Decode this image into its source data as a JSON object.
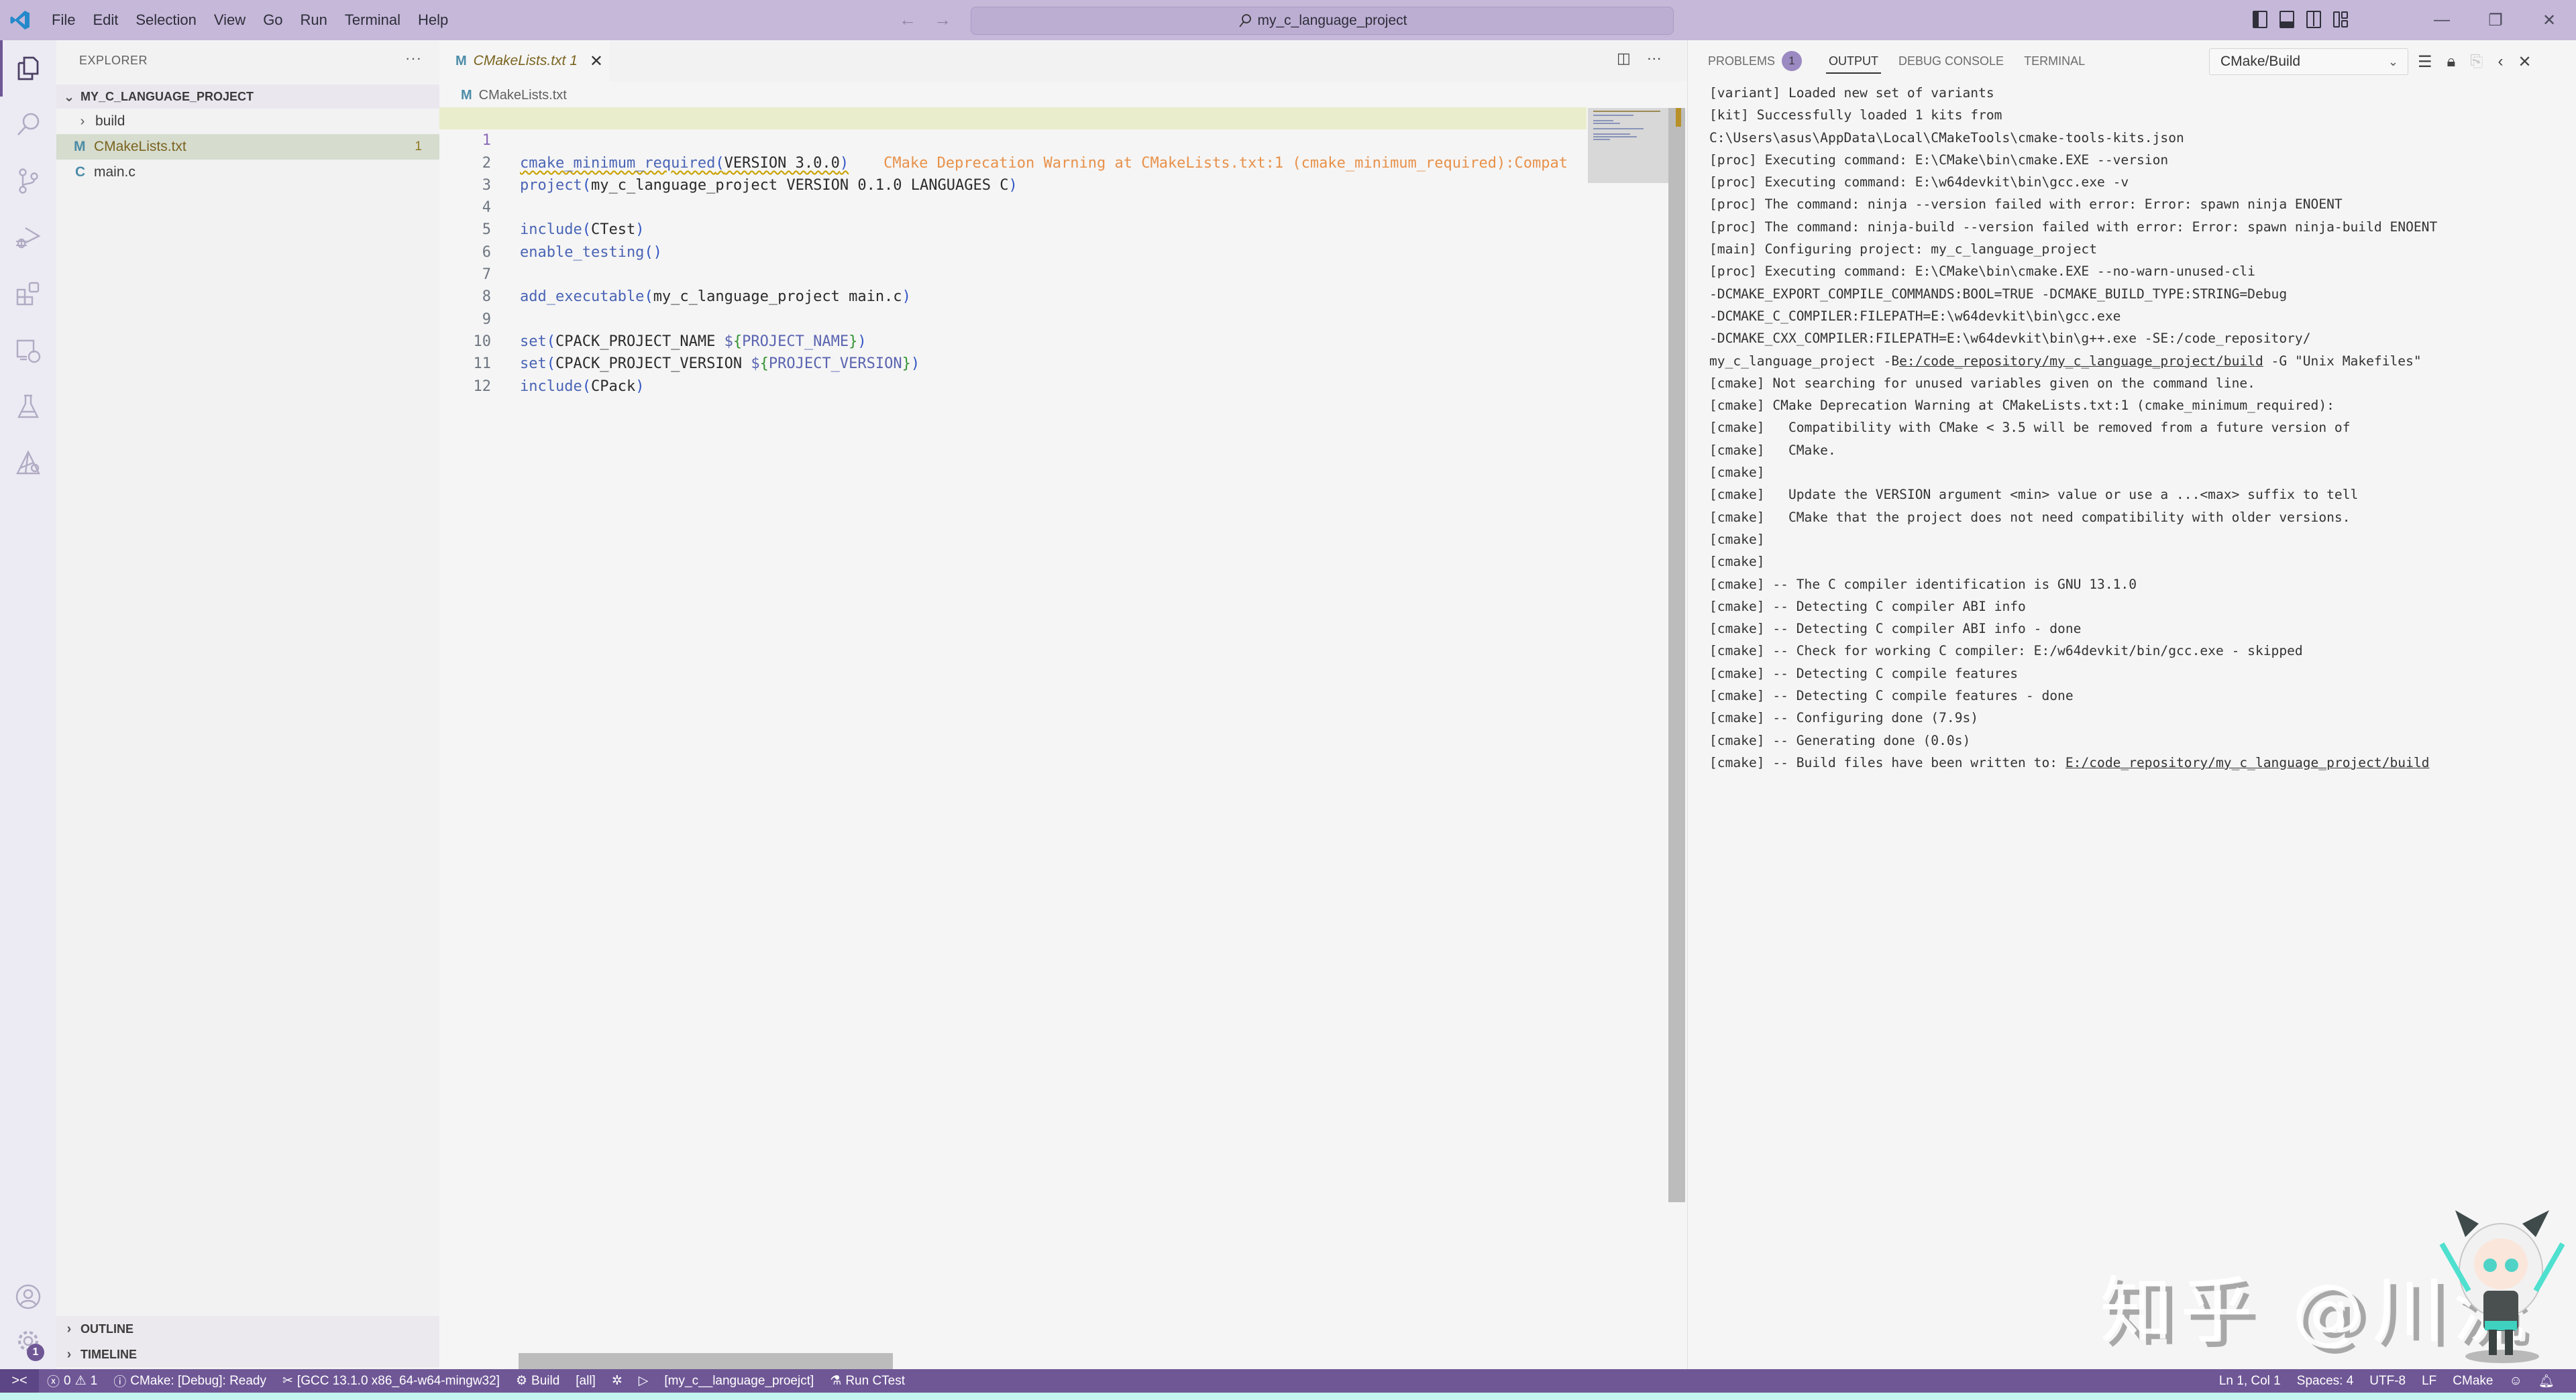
{
  "titlebar": {
    "menu": [
      "File",
      "Edit",
      "Selection",
      "View",
      "Go",
      "Run",
      "Terminal",
      "Help"
    ],
    "search_text": "my_c_language_project",
    "nav_back": "←",
    "nav_forward": "→",
    "window_controls": {
      "minimize": "—",
      "restore": "❐",
      "close": "✕"
    }
  },
  "activitybar": {
    "items": [
      "explorer",
      "search",
      "source-control",
      "run-and-debug",
      "extensions",
      "remote-explorer",
      "testing",
      "cmake"
    ],
    "bottom": [
      "accounts",
      "manage"
    ],
    "manage_badge": "1"
  },
  "sidebar": {
    "title": "EXPLORER",
    "more": "···",
    "project": "MY_C_LANGUAGE_PROJECT",
    "tree": [
      {
        "type": "folder",
        "name": "build",
        "icon": "›"
      },
      {
        "type": "file",
        "name": "CMakeLists.txt",
        "icon": "M",
        "count": "1",
        "selected": true
      },
      {
        "type": "file",
        "name": "main.c",
        "icon": "C"
      }
    ],
    "sections": [
      "OUTLINE",
      "TIMELINE"
    ]
  },
  "editor": {
    "tab": {
      "icon": "M",
      "label": "CMakeLists.txt 1",
      "close": "✕"
    },
    "breadcrumb": {
      "icon": "M",
      "label": "CMakeLists.txt"
    },
    "inline_warning": "CMake Deprecation Warning at CMakeLists.txt:1 (cmake_minimum_required):Compat",
    "lines": [
      {
        "n": "1",
        "fn": "cmake_minimum_required",
        "args": "VERSION 3.0.0"
      },
      {
        "n": "2",
        "fn": "project",
        "args": "my_c_language_project VERSION 0.1.0 LANGUAGES C"
      },
      {
        "n": "3"
      },
      {
        "n": "4",
        "fn": "include",
        "args": "CTest"
      },
      {
        "n": "5",
        "fn": "enable_testing",
        "args": ""
      },
      {
        "n": "6"
      },
      {
        "n": "7",
        "fn": "add_executable",
        "args": "my_c_language_project main.c"
      },
      {
        "n": "8"
      },
      {
        "n": "9",
        "fn": "set",
        "args": "CPACK_PROJECT_NAME ",
        "var": "PROJECT_NAME"
      },
      {
        "n": "10",
        "fn": "set",
        "args": "CPACK_PROJECT_VERSION ",
        "var": "PROJECT_VERSION"
      },
      {
        "n": "11",
        "fn": "include",
        "args": "CPack"
      },
      {
        "n": "12"
      }
    ]
  },
  "panel": {
    "tabs": [
      {
        "label": "PROBLEMS",
        "badge": "1"
      },
      {
        "label": "OUTPUT",
        "active": true
      },
      {
        "label": "DEBUG CONSOLE"
      },
      {
        "label": "TERMINAL"
      }
    ],
    "output_channel": "CMake/Build",
    "output": [
      "[variant] Loaded new set of variants",
      "[kit] Successfully loaded 1 kits from",
      "C:\\Users\\asus\\AppData\\Local\\CMakeTools\\cmake-tools-kits.json",
      "[proc] Executing command: E:\\CMake\\bin\\cmake.EXE --version",
      "[proc] Executing command: E:\\w64devkit\\bin\\gcc.exe -v",
      "[proc] The command: ninja --version failed with error: Error: spawn ninja ENOENT",
      "[proc] The command: ninja-build --version failed with error: Error: spawn ninja-build ENOENT",
      "[main] Configuring project: my_c_language_project",
      "[proc] Executing command: E:\\CMake\\bin\\cmake.EXE --no-warn-unused-cli",
      "-DCMAKE_EXPORT_COMPILE_COMMANDS:BOOL=TRUE -DCMAKE_BUILD_TYPE:STRING=Debug",
      "-DCMAKE_C_COMPILER:FILEPATH=E:\\w64devkit\\bin\\gcc.exe",
      "-DCMAKE_CXX_COMPILER:FILEPATH=E:\\w64devkit\\bin\\g++.exe -SE:/code_repository/",
      "my_c_language_project -Be:/code_repository/my_c_language_project/build -G \"Unix Makefiles\"",
      "[cmake] Not searching for unused variables given on the command line.",
      "[cmake] CMake Deprecation Warning at CMakeLists.txt:1 (cmake_minimum_required):",
      "[cmake]   Compatibility with CMake < 3.5 will be removed from a future version of",
      "[cmake]   CMake.",
      "[cmake]",
      "[cmake]   Update the VERSION argument <min> value or use a ...<max> suffix to tell",
      "[cmake]   CMake that the project does not need compatibility with older versions.",
      "[cmake]",
      "[cmake]",
      "[cmake] -- The C compiler identification is GNU 13.1.0",
      "[cmake] -- Detecting C compiler ABI info",
      "[cmake] -- Detecting C compiler ABI info - done",
      "[cmake] -- Check for working C compiler: E:/w64devkit/bin/gcc.exe - skipped",
      "[cmake] -- Detecting C compile features",
      "[cmake] -- Detecting C compile features - done",
      "[cmake] -- Configuring done (7.9s)",
      "[cmake] -- Generating done (0.0s)",
      "[cmake] -- Build files have been written to: E:/code_repository/my_c_language_project/build"
    ]
  },
  "watermark": "知乎 @川流",
  "statusbar": {
    "remote": "><",
    "errors": "0",
    "warnings": "1",
    "cmake_status": "CMake: [Debug]: Ready",
    "kit": "[GCC 13.1.0 x86_64-w64-mingw32]",
    "build": "Build",
    "target": "[all]",
    "launch_target": "[my_c__language_proejct]",
    "ctest": "Run CTest",
    "position": "Ln 1, Col 1",
    "spaces": "Spaces: 4",
    "encoding": "UTF-8",
    "eol": "LF",
    "language": "CMake"
  },
  "colors": {
    "accent": "#6f5796",
    "titlebar": "#c5b8d9",
    "warning": "#e8914a"
  }
}
